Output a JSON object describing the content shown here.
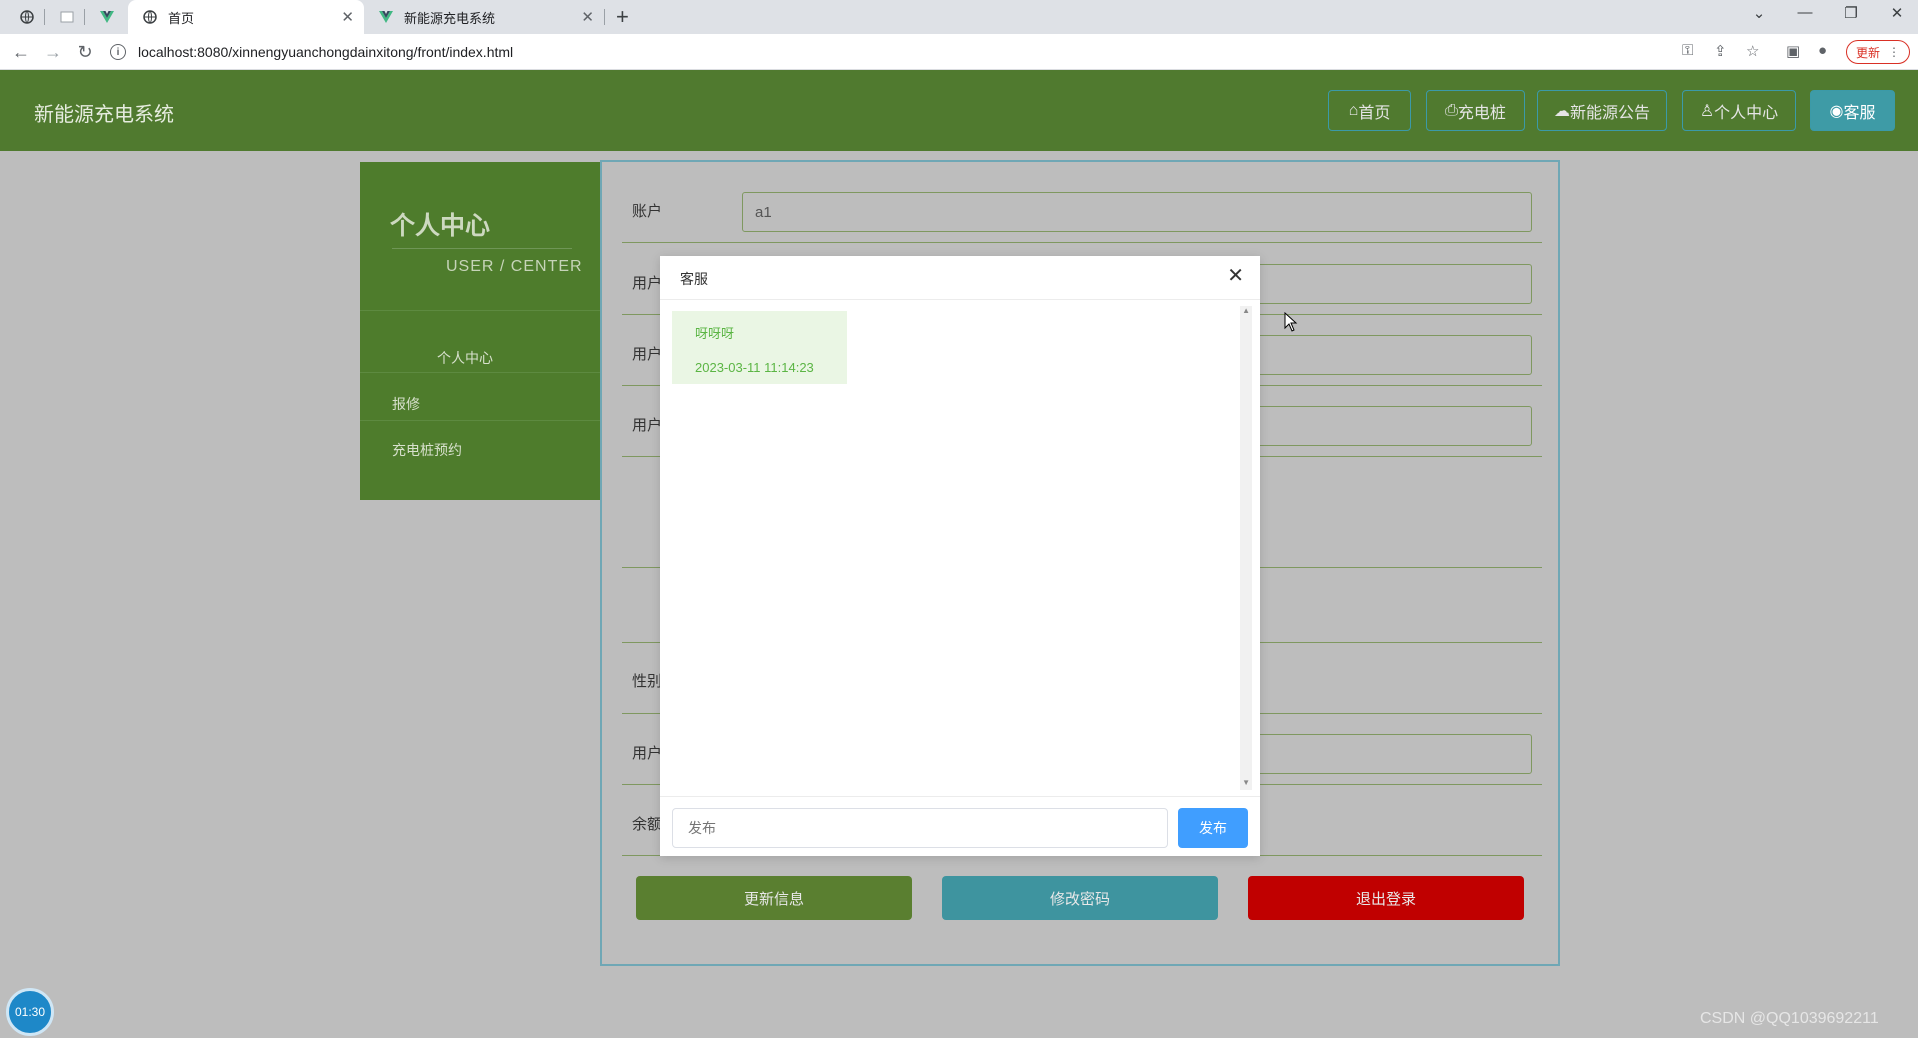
{
  "browser": {
    "tabs": [
      {
        "label": "首页",
        "active": true
      },
      {
        "label": "新能源充电系统",
        "active": false
      }
    ],
    "url": "localhost:8080/xinnengyuanchongdainxitong/front/index.html",
    "update_label": "更新"
  },
  "header": {
    "title": "新能源充电系统",
    "nav": [
      {
        "label": "首页",
        "icon": "home-icon"
      },
      {
        "label": "充电桩",
        "icon": "printer-icon"
      },
      {
        "label": "新能源公告",
        "icon": "cloud-icon"
      },
      {
        "label": "个人中心",
        "icon": "user-icon"
      },
      {
        "label": "客服",
        "icon": "chat-icon"
      }
    ]
  },
  "sidebar": {
    "title": "个人中心",
    "subtitle": "USER / CENTER",
    "items": [
      {
        "label": "个人中心"
      },
      {
        "label": "报修"
      },
      {
        "label": "充电桩预约"
      }
    ]
  },
  "form": {
    "account_label": "账户",
    "account_value": "a1",
    "label_2": "用户",
    "label_3": "用户",
    "label_4": "用户",
    "gender_label": "性别",
    "label_phone": "用户",
    "balance_label": "余额",
    "buttons": {
      "update": "更新信息",
      "change_password": "修改密码",
      "logout": "退出登录"
    }
  },
  "modal": {
    "title": "客服",
    "messages": [
      {
        "text": "呀呀呀",
        "time": "2023-03-11 11:14:23"
      }
    ],
    "input_placeholder": "发布",
    "submit_label": "发布"
  },
  "overlay": {
    "timer": "01:30",
    "watermark": "CSDN @QQ1039692211"
  },
  "colors": {
    "header_bg": "#507a2f",
    "sidebar_bg": "#4e7c2c",
    "update_btn": "#5a7f30",
    "password_btn": "#3e949f",
    "logout_btn": "#c00000",
    "post_btn": "#409eff",
    "message_text": "#5bb544"
  }
}
